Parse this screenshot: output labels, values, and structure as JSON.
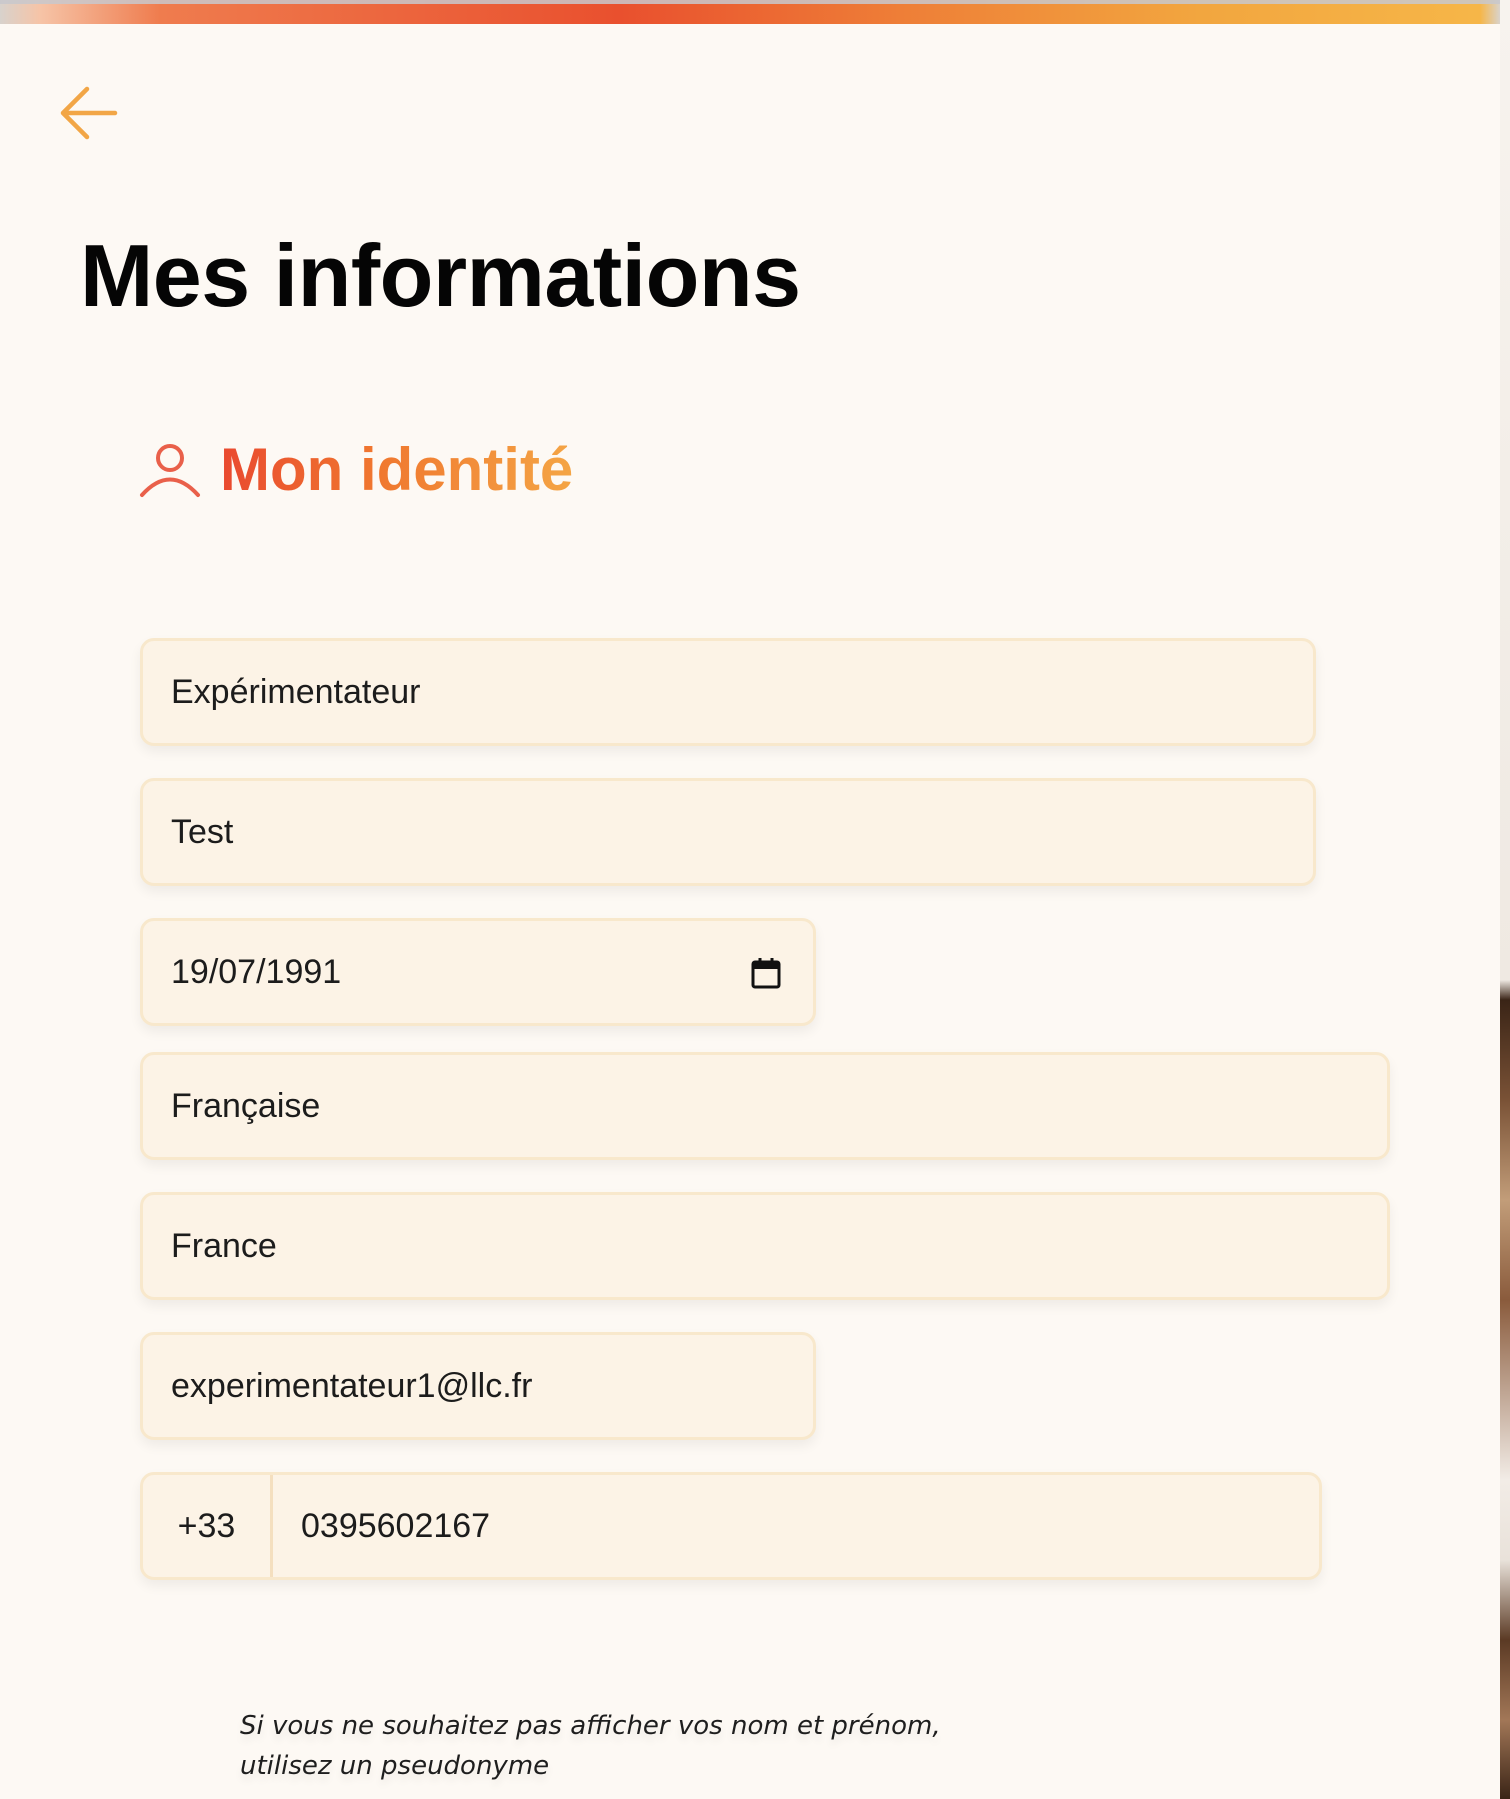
{
  "header": {
    "title": "Mes informations"
  },
  "section": {
    "title": "Mon identité",
    "icon": "person-icon"
  },
  "colors": {
    "accent_start": "#e9492f",
    "accent_end": "#f4a545",
    "field_background": "#fcf3e6",
    "field_border": "#f8e8cc",
    "page_background": "#fdf9f4"
  },
  "form": {
    "last_name": "Expérimentateur",
    "first_name": "Test",
    "birth_date": "19/07/1991",
    "nationality": "Française",
    "country": "France",
    "email": "experimentateur1@llc.fr",
    "phone_prefix": "+33",
    "phone_number": "0395602167"
  },
  "hint": {
    "text": "Si vous ne souhaitez pas afficher vos nom et prénom, utilisez un pseudonyme"
  }
}
